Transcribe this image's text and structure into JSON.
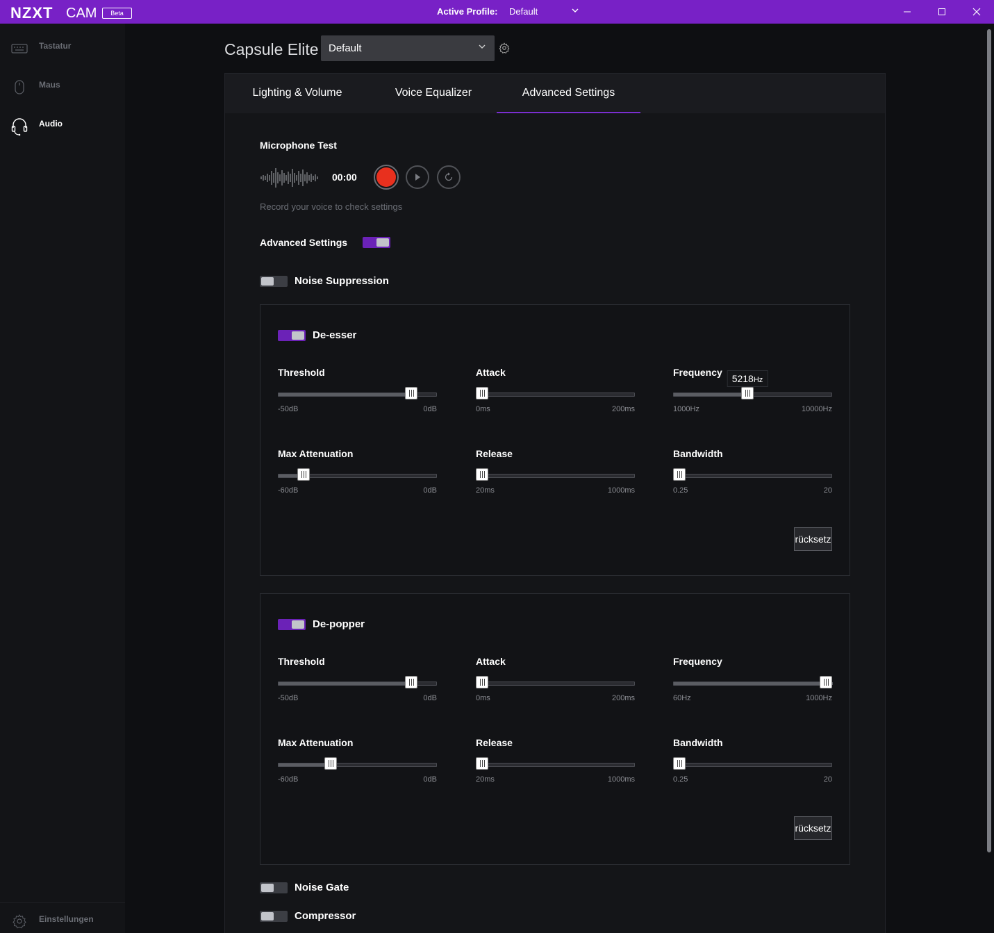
{
  "titlebar": {
    "logo": "NZXT",
    "logo_suffix": "CAM",
    "beta": "Beta",
    "active_profile_label": "Active Profile:",
    "active_profile_value": "Default",
    "accent": "#7821c6"
  },
  "sidebar": {
    "items": [
      {
        "label": "Tastatur",
        "icon": "keyboard-icon"
      },
      {
        "label": "Maus",
        "icon": "mouse-icon"
      },
      {
        "label": "Audio",
        "icon": "headset-icon",
        "active": true
      }
    ],
    "settings": {
      "label": "Einstellungen",
      "icon": "gear-icon"
    }
  },
  "header": {
    "device": "Capsule Elite",
    "profile": "Default"
  },
  "tabs": [
    "Lighting & Volume",
    "Voice Equalizer",
    "Advanced Settings"
  ],
  "active_tab": "Advanced Settings",
  "mic_test": {
    "title": "Microphone Test",
    "time": "00:00",
    "hint": "Record your voice to check settings"
  },
  "advanced": {
    "label": "Advanced Settings",
    "on": true
  },
  "noise_suppression": {
    "label": "Noise Suppression",
    "on": false
  },
  "deesser": {
    "label": "De-esser",
    "on": true,
    "reset": "rücksetz",
    "params": {
      "threshold": {
        "title": "Threshold",
        "min": "-50dB",
        "max": "0dB",
        "pos": 0.84
      },
      "attack": {
        "title": "Attack",
        "min": "0ms",
        "max": "200ms",
        "pos": 0.0
      },
      "frequency": {
        "title": "Frequency",
        "min": "1000Hz",
        "max": "10000Hz",
        "pos": 0.469,
        "tooltip_value": "5218",
        "tooltip_unit": "Hz"
      },
      "max_attenuation": {
        "title": "Max Attenuation",
        "min": "-60dB",
        "max": "0dB",
        "pos": 0.16
      },
      "release": {
        "title": "Release",
        "min": "20ms",
        "max": "1000ms",
        "pos": 0.0
      },
      "bandwidth": {
        "title": "Bandwidth",
        "min": "0.25",
        "max": "20",
        "pos": 0.04
      }
    }
  },
  "depopper": {
    "label": "De-popper",
    "on": true,
    "reset": "rücksetz",
    "params": {
      "threshold": {
        "title": "Threshold",
        "min": "-50dB",
        "max": "0dB",
        "pos": 0.84
      },
      "attack": {
        "title": "Attack",
        "min": "0ms",
        "max": "200ms",
        "pos": 0.0
      },
      "frequency": {
        "title": "Frequency",
        "min": "60Hz",
        "max": "1000Hz",
        "pos": 1.0
      },
      "max_attenuation": {
        "title": "Max Attenuation",
        "min": "-60dB",
        "max": "0dB",
        "pos": 0.33
      },
      "release": {
        "title": "Release",
        "min": "20ms",
        "max": "1000ms",
        "pos": 0.0
      },
      "bandwidth": {
        "title": "Bandwidth",
        "min": "0.25",
        "max": "20",
        "pos": 0.0
      }
    }
  },
  "noise_gate": {
    "label": "Noise Gate",
    "on": false
  },
  "compressor": {
    "label": "Compressor",
    "on": false
  }
}
